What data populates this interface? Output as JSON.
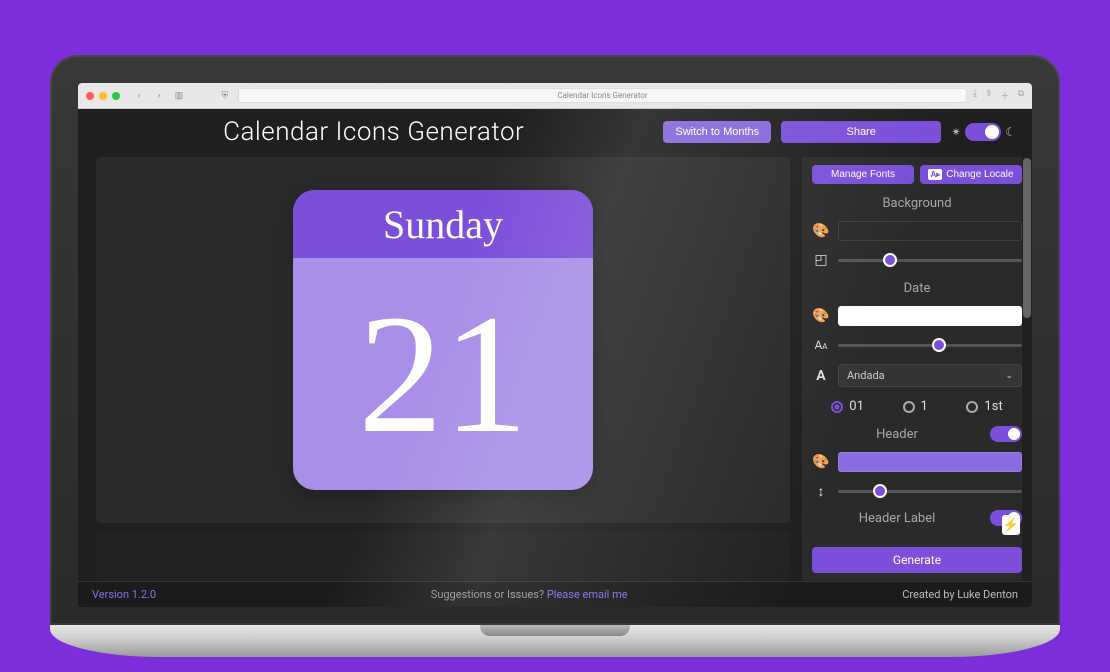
{
  "browser": {
    "page_title": "Calendar Icons Generator"
  },
  "header": {
    "title": "Calendar Icons Generator",
    "switch_label": "Switch to Months",
    "share_label": "Share"
  },
  "preview": {
    "day_name": "Sunday",
    "day_number": "21"
  },
  "panel": {
    "manage_fonts_label": "Manage Fonts",
    "change_locale_label": "Change Locale",
    "background": {
      "title": "Background",
      "color": "#b49be9",
      "radius_pct": 28
    },
    "date": {
      "title": "Date",
      "color": "#ffffff",
      "size_pct": 55,
      "font_selected": "Andada",
      "format_options": [
        "01",
        "1",
        "1st"
      ],
      "format_selected": "01"
    },
    "header_group": {
      "title": "Header",
      "enabled": true,
      "color": "#8a6ce0",
      "height_pct": 23
    },
    "header_label_group": {
      "title": "Header Label",
      "enabled": true
    },
    "generate_label": "Generate"
  },
  "footer": {
    "version": "Version 1.2.0",
    "suggestions_prefix": "Suggestions or Issues? ",
    "suggestions_link": "Please email me",
    "credit": "Created by Luke Denton"
  }
}
